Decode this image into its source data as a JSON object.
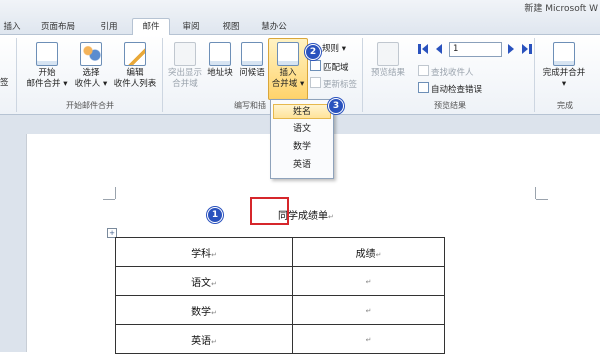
{
  "window": {
    "title": "新建 Microsoft W"
  },
  "tabs": [
    {
      "label": "插入"
    },
    {
      "label": "页面布局"
    },
    {
      "label": "引用"
    },
    {
      "label": "邮件",
      "active": true
    },
    {
      "label": "审阅"
    },
    {
      "label": "视图"
    },
    {
      "label": "慧办公"
    }
  ],
  "ribbon": {
    "left_cut_label": "签",
    "group_start": {
      "label": "开始邮件合并",
      "start_btn": [
        "开始",
        "邮件合并 ▾"
      ],
      "select_btn": [
        "选择",
        "收件人 ▾"
      ],
      "edit_btn": [
        "编辑",
        "收件人列表"
      ]
    },
    "group_fields": {
      "label": "编写和插",
      "highlight_btn": [
        "突出显示",
        "合并域"
      ],
      "address_btn": "地址块",
      "greeting_btn": "问候语",
      "insert_field_btn": [
        "插入",
        "合并域 ▾"
      ],
      "rules": "规则 ▾",
      "match_fields": "匹配域",
      "update_labels": "更新标签"
    },
    "group_preview": {
      "label": "预览结果",
      "preview_btn": "预览结果",
      "record_value": "1",
      "find_recipient": "查找收件人",
      "auto_check": "自动检查错误"
    },
    "group_finish": {
      "label": "完成",
      "finish_btn": [
        "完成并合并",
        "▾"
      ]
    }
  },
  "annotations": {
    "b1": "1",
    "b2": "2",
    "b3": "3"
  },
  "dropdown": {
    "items": [
      {
        "label": "姓名",
        "highlighted": true
      },
      {
        "label": "语文"
      },
      {
        "label": "数学"
      },
      {
        "label": "英语"
      }
    ]
  },
  "document": {
    "title": "同学成绩单",
    "paragraph_mark": "↵",
    "table": {
      "headers": [
        "学科",
        "成绩"
      ],
      "rows": [
        [
          "语文",
          ""
        ],
        [
          "数学",
          ""
        ],
        [
          "英语",
          ""
        ]
      ]
    }
  },
  "colors": {
    "accent_blue": "#2a52be",
    "highlight_red": "#d6262b",
    "ribbon_active": "#ffd36b"
  }
}
